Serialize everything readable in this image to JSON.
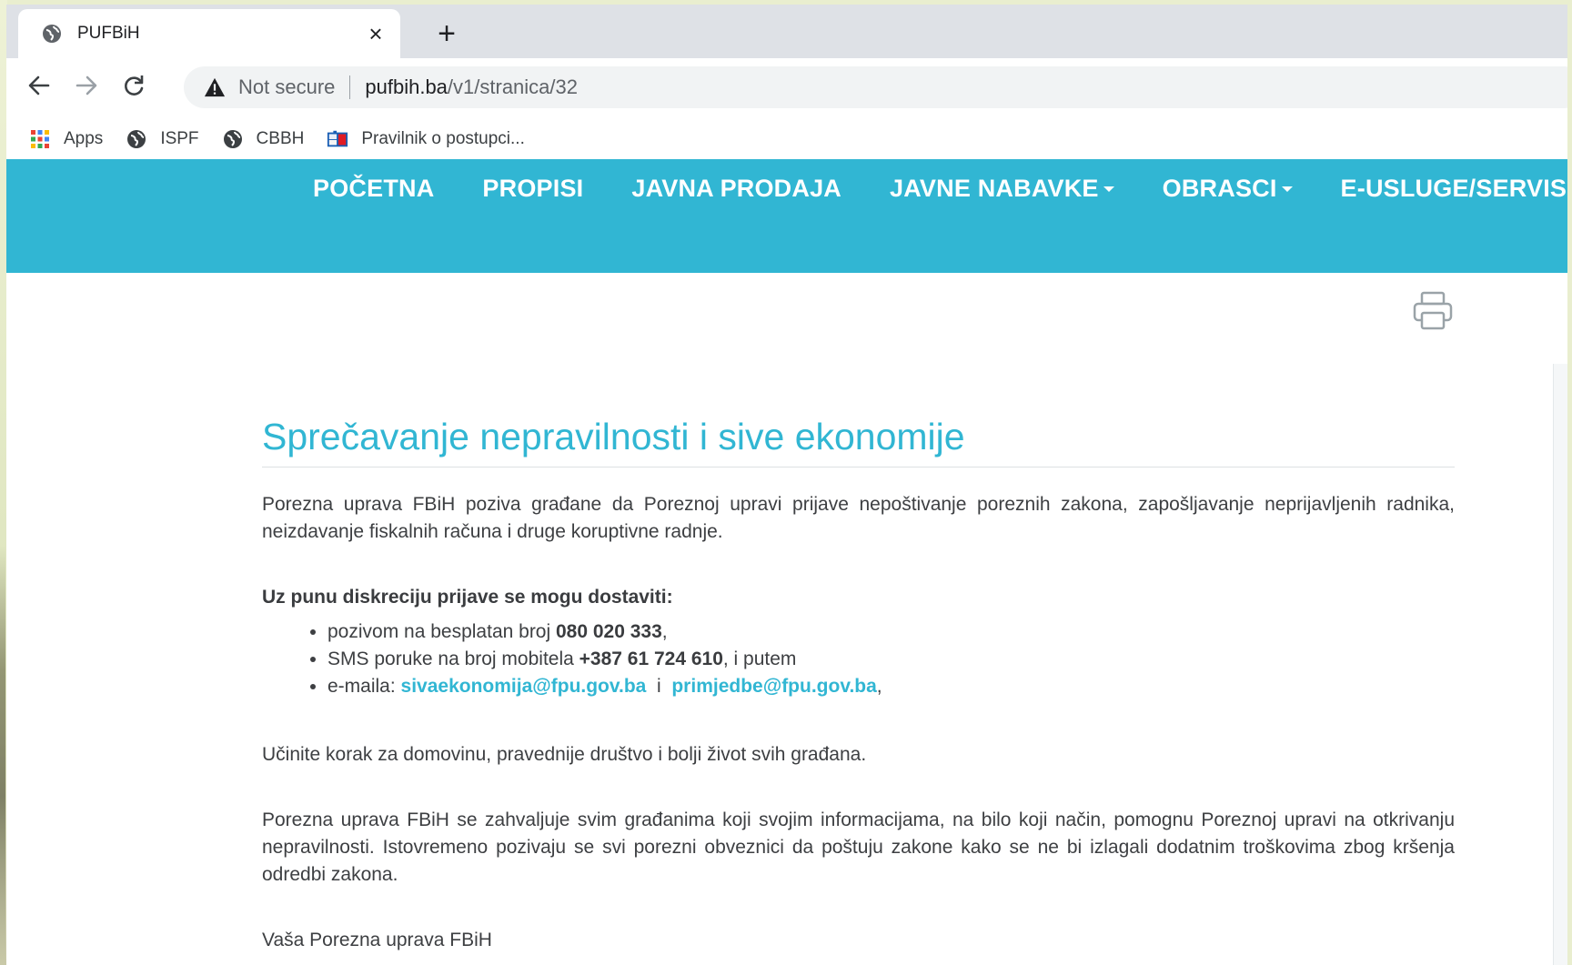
{
  "browser": {
    "tab": {
      "title": "PUFBiH",
      "close": "×"
    },
    "new_tab": "+",
    "security": "Not secure",
    "url_host": "pufbih.ba",
    "url_path": "/v1/stranica/32",
    "bookmarks": [
      {
        "label": "Apps",
        "icon": "apps-grid-icon"
      },
      {
        "label": "ISPF",
        "icon": "globe-icon"
      },
      {
        "label": "CBBH",
        "icon": "globe-icon"
      },
      {
        "label": "Pravilnik o postupci...",
        "icon": "document-icon"
      }
    ]
  },
  "site": {
    "nav": [
      {
        "label": "POČETNA",
        "dropdown": false
      },
      {
        "label": "PROPISI",
        "dropdown": false
      },
      {
        "label": "JAVNA PRODAJA",
        "dropdown": false
      },
      {
        "label": "JAVNE NABAVKE",
        "dropdown": true
      },
      {
        "label": "OBRASCI",
        "dropdown": true
      },
      {
        "label": "E-USLUGE/SERVISI",
        "dropdown": true
      }
    ],
    "colors": {
      "brand": "#31b6d3",
      "text": "#3d3f42"
    }
  },
  "article": {
    "title": "Sprečavanje nepravilnosti i sive ekonomije",
    "intro": "Porezna uprava FBiH poziva građane da Poreznoj upravi prijave nepoštivanje poreznih zakona, zapošljavanje neprijavljenih radnika, neizdavanje fiskalnih računa i druge koruptivne radnje.",
    "lead": "Uz punu diskreciju prijave se mogu dostaviti:",
    "item1_pre": "pozivom na besplatan broj ",
    "item1_num": "080 020 333",
    "item1_post": ",",
    "item2_pre": "SMS poruke na broj mobitela ",
    "item2_num": "+387 61 724 610",
    "item2_post": ", i putem",
    "item3_pre": "e-maila: ",
    "email1": "sivaekonomija@fpu.gov.ba",
    "item3_mid": "  i  ",
    "email2": "primjedbe@fpu.gov.ba",
    "item3_post": ",",
    "call": "Učinite korak za domovinu, pravednije društvo i bolji život svih građana.",
    "thanks": "Porezna uprava FBiH se zahvaljuje svim građanima koji svojim informacijama, na bilo koji način, pomognu Poreznoj upravi na otkrivanju nepravilnosti. Istovremeno pozivaju se svi porezni obveznici da poštuju zakone kako se ne bi izlagali dodatnim troškovima zbog kršenja odredbi zakona.",
    "signature": "Vaša Porezna uprava FBiH"
  }
}
